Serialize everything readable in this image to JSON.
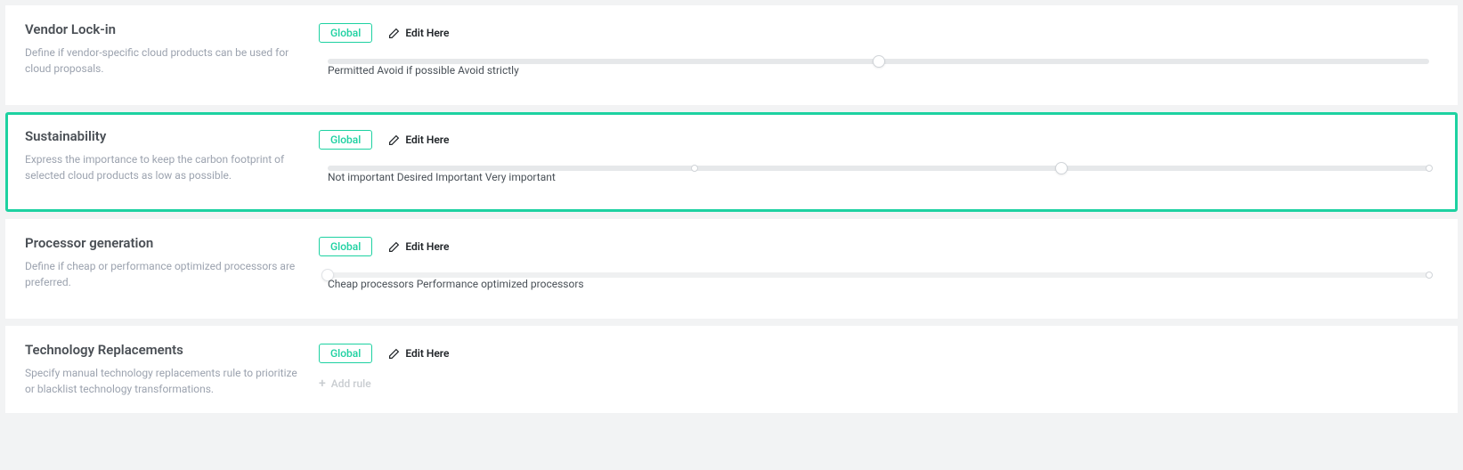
{
  "panels": {
    "vendor": {
      "title": "Vendor Lock-in",
      "desc": "Define if vendor-specific cloud products can be used for cloud proposals.",
      "badge": "Global",
      "edit": "Edit Here",
      "labels": {
        "l0": "Permitted",
        "l1": "Avoid if possible",
        "l2": "Avoid strictly"
      },
      "thumb_pct": 50
    },
    "sustain": {
      "title": "Sustainability",
      "desc": "Express the importance to keep the carbon footprint of selected cloud products as low as possible.",
      "badge": "Global",
      "edit": "Edit Here",
      "labels": {
        "l0": "Not important",
        "l1": "Desired",
        "l2": "Important",
        "l3": "Very important"
      },
      "thumb_pct": 66.6
    },
    "proc": {
      "title": "Processor generation",
      "desc": "Define if cheap or performance optimized processors are preferred.",
      "badge": "Global",
      "edit": "Edit Here",
      "labels": {
        "l0": "Cheap processors",
        "l1": "Performance optimized processors"
      },
      "thumb_pct": 0
    },
    "tech": {
      "title": "Technology Replacements",
      "desc": "Specify manual technology replacements rule to prioritize or blacklist technology transformations.",
      "badge": "Global",
      "edit": "Edit Here",
      "add_rule": "Add rule"
    }
  }
}
